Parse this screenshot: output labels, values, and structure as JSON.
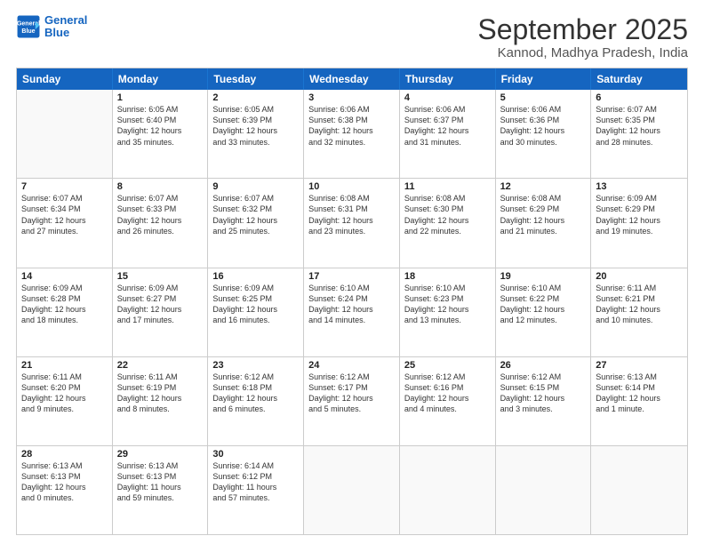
{
  "header": {
    "logo_line1": "General",
    "logo_line2": "Blue",
    "main_title": "September 2025",
    "subtitle": "Kannod, Madhya Pradesh, India"
  },
  "weekdays": [
    "Sunday",
    "Monday",
    "Tuesday",
    "Wednesday",
    "Thursday",
    "Friday",
    "Saturday"
  ],
  "weeks": [
    [
      {
        "day": "",
        "info": ""
      },
      {
        "day": "1",
        "info": "Sunrise: 6:05 AM\nSunset: 6:40 PM\nDaylight: 12 hours\nand 35 minutes."
      },
      {
        "day": "2",
        "info": "Sunrise: 6:05 AM\nSunset: 6:39 PM\nDaylight: 12 hours\nand 33 minutes."
      },
      {
        "day": "3",
        "info": "Sunrise: 6:06 AM\nSunset: 6:38 PM\nDaylight: 12 hours\nand 32 minutes."
      },
      {
        "day": "4",
        "info": "Sunrise: 6:06 AM\nSunset: 6:37 PM\nDaylight: 12 hours\nand 31 minutes."
      },
      {
        "day": "5",
        "info": "Sunrise: 6:06 AM\nSunset: 6:36 PM\nDaylight: 12 hours\nand 30 minutes."
      },
      {
        "day": "6",
        "info": "Sunrise: 6:07 AM\nSunset: 6:35 PM\nDaylight: 12 hours\nand 28 minutes."
      }
    ],
    [
      {
        "day": "7",
        "info": "Sunrise: 6:07 AM\nSunset: 6:34 PM\nDaylight: 12 hours\nand 27 minutes."
      },
      {
        "day": "8",
        "info": "Sunrise: 6:07 AM\nSunset: 6:33 PM\nDaylight: 12 hours\nand 26 minutes."
      },
      {
        "day": "9",
        "info": "Sunrise: 6:07 AM\nSunset: 6:32 PM\nDaylight: 12 hours\nand 25 minutes."
      },
      {
        "day": "10",
        "info": "Sunrise: 6:08 AM\nSunset: 6:31 PM\nDaylight: 12 hours\nand 23 minutes."
      },
      {
        "day": "11",
        "info": "Sunrise: 6:08 AM\nSunset: 6:30 PM\nDaylight: 12 hours\nand 22 minutes."
      },
      {
        "day": "12",
        "info": "Sunrise: 6:08 AM\nSunset: 6:29 PM\nDaylight: 12 hours\nand 21 minutes."
      },
      {
        "day": "13",
        "info": "Sunrise: 6:09 AM\nSunset: 6:29 PM\nDaylight: 12 hours\nand 19 minutes."
      }
    ],
    [
      {
        "day": "14",
        "info": "Sunrise: 6:09 AM\nSunset: 6:28 PM\nDaylight: 12 hours\nand 18 minutes."
      },
      {
        "day": "15",
        "info": "Sunrise: 6:09 AM\nSunset: 6:27 PM\nDaylight: 12 hours\nand 17 minutes."
      },
      {
        "day": "16",
        "info": "Sunrise: 6:09 AM\nSunset: 6:25 PM\nDaylight: 12 hours\nand 16 minutes."
      },
      {
        "day": "17",
        "info": "Sunrise: 6:10 AM\nSunset: 6:24 PM\nDaylight: 12 hours\nand 14 minutes."
      },
      {
        "day": "18",
        "info": "Sunrise: 6:10 AM\nSunset: 6:23 PM\nDaylight: 12 hours\nand 13 minutes."
      },
      {
        "day": "19",
        "info": "Sunrise: 6:10 AM\nSunset: 6:22 PM\nDaylight: 12 hours\nand 12 minutes."
      },
      {
        "day": "20",
        "info": "Sunrise: 6:11 AM\nSunset: 6:21 PM\nDaylight: 12 hours\nand 10 minutes."
      }
    ],
    [
      {
        "day": "21",
        "info": "Sunrise: 6:11 AM\nSunset: 6:20 PM\nDaylight: 12 hours\nand 9 minutes."
      },
      {
        "day": "22",
        "info": "Sunrise: 6:11 AM\nSunset: 6:19 PM\nDaylight: 12 hours\nand 8 minutes."
      },
      {
        "day": "23",
        "info": "Sunrise: 6:12 AM\nSunset: 6:18 PM\nDaylight: 12 hours\nand 6 minutes."
      },
      {
        "day": "24",
        "info": "Sunrise: 6:12 AM\nSunset: 6:17 PM\nDaylight: 12 hours\nand 5 minutes."
      },
      {
        "day": "25",
        "info": "Sunrise: 6:12 AM\nSunset: 6:16 PM\nDaylight: 12 hours\nand 4 minutes."
      },
      {
        "day": "26",
        "info": "Sunrise: 6:12 AM\nSunset: 6:15 PM\nDaylight: 12 hours\nand 3 minutes."
      },
      {
        "day": "27",
        "info": "Sunrise: 6:13 AM\nSunset: 6:14 PM\nDaylight: 12 hours\nand 1 minute."
      }
    ],
    [
      {
        "day": "28",
        "info": "Sunrise: 6:13 AM\nSunset: 6:13 PM\nDaylight: 12 hours\nand 0 minutes."
      },
      {
        "day": "29",
        "info": "Sunrise: 6:13 AM\nSunset: 6:13 PM\nDaylight: 11 hours\nand 59 minutes."
      },
      {
        "day": "30",
        "info": "Sunrise: 6:14 AM\nSunset: 6:12 PM\nDaylight: 11 hours\nand 57 minutes."
      },
      {
        "day": "",
        "info": ""
      },
      {
        "day": "",
        "info": ""
      },
      {
        "day": "",
        "info": ""
      },
      {
        "day": "",
        "info": ""
      }
    ]
  ]
}
